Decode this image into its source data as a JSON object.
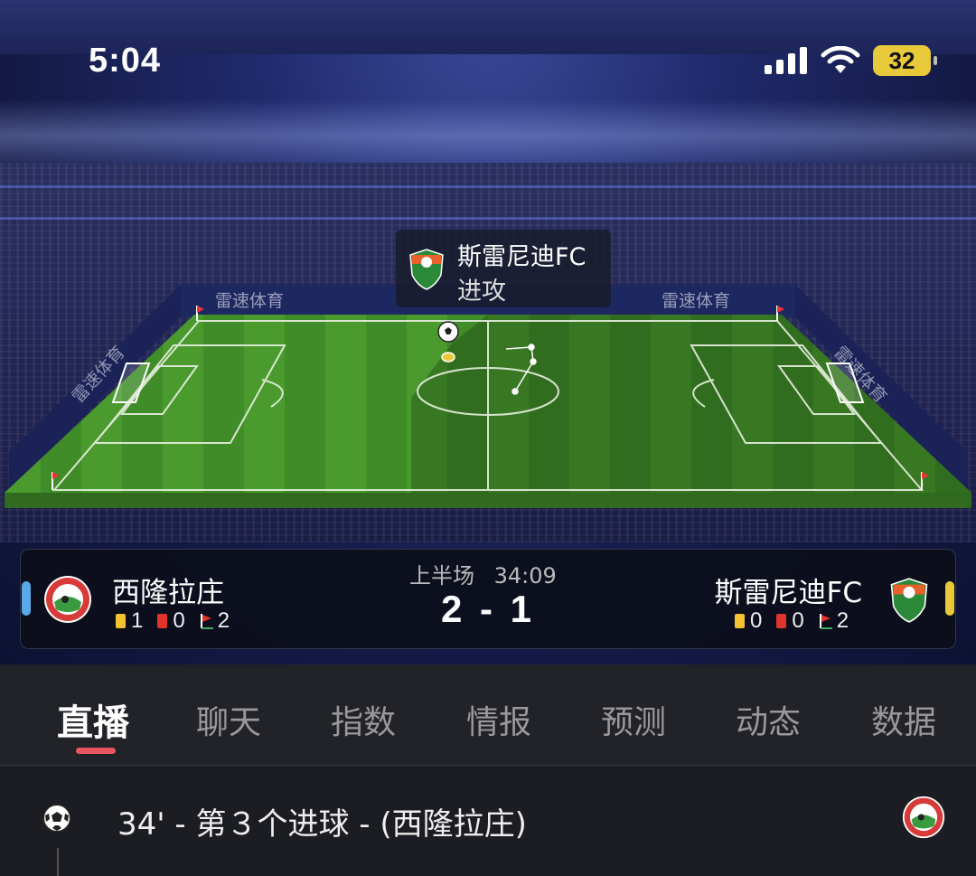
{
  "status_bar": {
    "time": "5:04",
    "battery": "32",
    "icons": [
      "signal-icon",
      "wifi-icon",
      "battery-icon"
    ]
  },
  "pitch": {
    "boards": [
      "雷速体育",
      "雷速体育",
      "雷速体育",
      "雷速体育"
    ],
    "logo_colors": {
      "pitch": "#3f8f2a",
      "dark_shade": "#2a6420"
    }
  },
  "attack_popup": {
    "team": "斯雷尼迪FC",
    "action": "进攻"
  },
  "match": {
    "period": "上半场",
    "clock": "34:09",
    "score": "2 - 1",
    "home": {
      "name": "西隆拉庄",
      "yellow": "1",
      "red": "0",
      "corners": "2",
      "side_color": "#5aa8e8"
    },
    "away": {
      "name": "斯雷尼迪FC",
      "yellow": "0",
      "red": "0",
      "corners": "2",
      "side_color": "#e8c93a"
    }
  },
  "tabs": [
    {
      "label": "直播",
      "active": true
    },
    {
      "label": "聊天"
    },
    {
      "label": "指数"
    },
    {
      "label": "情报"
    },
    {
      "label": "预测"
    },
    {
      "label": "动态"
    },
    {
      "label": "数据"
    }
  ],
  "events": [
    {
      "text": "34' - 第３个进球 - (西隆拉庄)",
      "icon": "soccer-ball-icon"
    }
  ]
}
